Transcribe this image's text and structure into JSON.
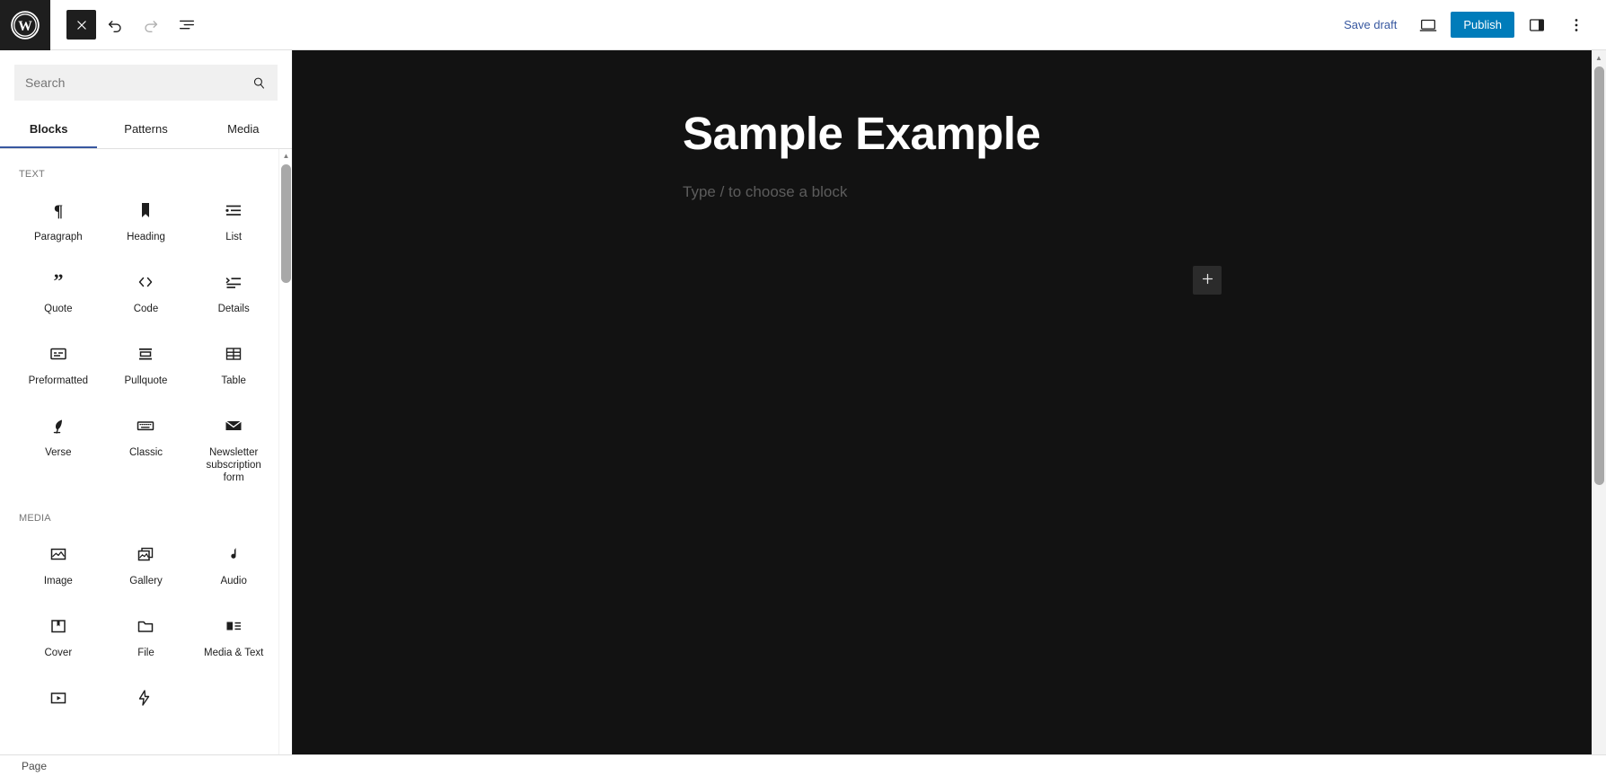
{
  "header": {
    "logo_icon": "wordpress-logo-icon",
    "close_inserter_icon": "close-x-icon",
    "undo_icon": "undo-arrow-icon",
    "redo_icon": "redo-arrow-icon",
    "list_view_icon": "document-list-view-icon",
    "save_draft_label": "Save draft",
    "preview_icon": "desktop-preview-icon",
    "publish_label": "Publish",
    "sidebar_toggle_icon": "settings-sidebar-icon",
    "more_options_icon": "three-dots-vertical-icon",
    "publish_button_color": "#007cba",
    "save_draft_color": "#3858a0"
  },
  "inserter": {
    "search": {
      "placeholder": "Search",
      "value": "",
      "icon": "search-magnifier-icon"
    },
    "tabs": [
      {
        "label": "Blocks",
        "active": true
      },
      {
        "label": "Patterns",
        "active": false
      },
      {
        "label": "Media",
        "active": false
      }
    ],
    "active_tab_indicator_color": "#3858a0",
    "sections": [
      {
        "title": "TEXT",
        "blocks": [
          {
            "label": "Paragraph",
            "icon": "pilcrow-icon"
          },
          {
            "label": "Heading",
            "icon": "bookmark-heading-icon"
          },
          {
            "label": "List",
            "icon": "bulleted-list-icon"
          },
          {
            "label": "Quote",
            "icon": "quotation-marks-icon"
          },
          {
            "label": "Code",
            "icon": "angle-brackets-code-icon"
          },
          {
            "label": "Details",
            "icon": "details-disclosure-icon"
          },
          {
            "label": "Preformatted",
            "icon": "preformatted-box-icon"
          },
          {
            "label": "Pullquote",
            "icon": "pullquote-bars-icon"
          },
          {
            "label": "Table",
            "icon": "table-grid-icon"
          },
          {
            "label": "Verse",
            "icon": "quill-pen-icon"
          },
          {
            "label": "Classic",
            "icon": "keyboard-icon"
          },
          {
            "label": "Newsletter subscription form",
            "icon": "envelope-mail-icon"
          }
        ]
      },
      {
        "title": "MEDIA",
        "blocks": [
          {
            "label": "Image",
            "icon": "picture-image-icon"
          },
          {
            "label": "Gallery",
            "icon": "stacked-images-gallery-icon"
          },
          {
            "label": "Audio",
            "icon": "music-note-audio-icon"
          },
          {
            "label": "Cover",
            "icon": "cover-bookmark-icon"
          },
          {
            "label": "File",
            "icon": "folder-file-icon"
          },
          {
            "label": "Media & Text",
            "icon": "media-and-text-icon"
          },
          {
            "label": "",
            "icon": "video-play-icon"
          },
          {
            "label": "",
            "icon": "lightning-bolt-icon"
          }
        ]
      }
    ],
    "scrollbar": {
      "up_arrow_icon": "scroll-up-arrow-icon",
      "down_arrow_icon": "scroll-down-arrow-icon"
    }
  },
  "editor": {
    "title": "Sample Example",
    "placeholder": "Type / to choose a block",
    "add_block_icon": "plus-add-block-icon",
    "canvas_background": "#121212",
    "title_color": "#ffffff",
    "placeholder_color": "#5c5c5c"
  },
  "canvas_scrollbar": {
    "up_arrow_icon": "scroll-up-arrow-icon"
  },
  "status_bar": {
    "label": "Page"
  }
}
